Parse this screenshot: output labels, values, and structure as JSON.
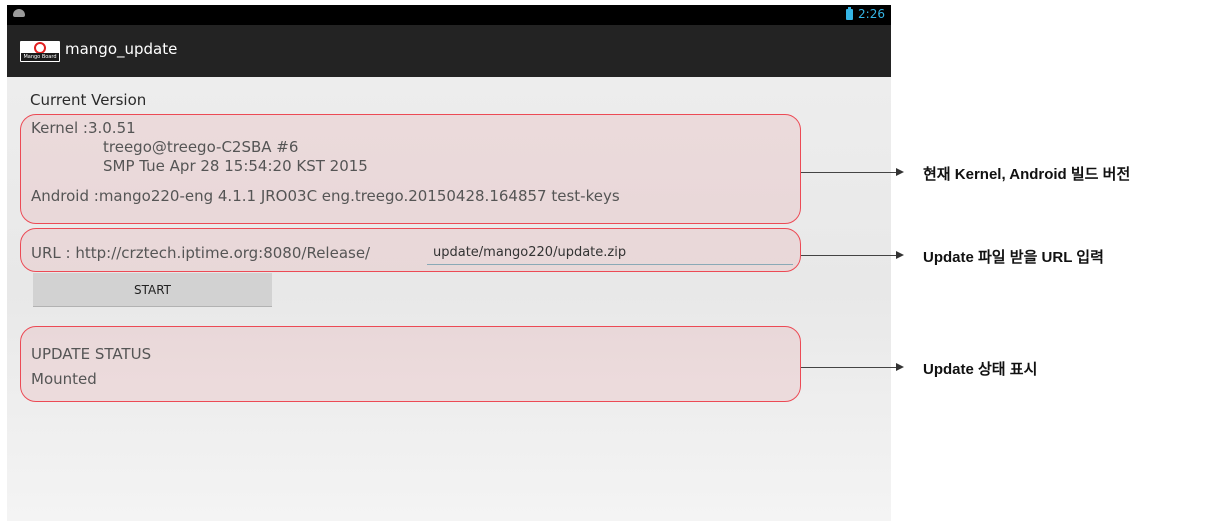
{
  "statusbar": {
    "time": "2:26",
    "notification_icon": "android-icon",
    "battery_icon": "battery-icon",
    "accent_color": "#35b5e5"
  },
  "actionbar": {
    "logo_text": "Mango Board",
    "title": "mango_update"
  },
  "current_version": {
    "heading": "Current Version",
    "kernel_line": "Kernel :3.0.51",
    "kernel_user": "treego@treego-C2SBA #6",
    "kernel_build": "SMP Tue Apr 28 15:54:20 KST 2015",
    "android_line": "Android :mango220-eng 4.1.1 JRO03C eng.treego.20150428.164857 test-keys"
  },
  "url": {
    "label": "URL : http://crztech.iptime.org:8080/Release/",
    "value": "update/mango220/update.zip"
  },
  "start_button": {
    "label": "START"
  },
  "update_status": {
    "heading": "UPDATE STATUS",
    "value": "Mounted"
  },
  "annotations": {
    "version": "현재 Kernel, Android 빌드 버전",
    "url": "Update 파일 받을 URL 입력",
    "status": "Update 상태 표시"
  },
  "colors": {
    "highlight_border": "#ec4a55",
    "actionbar": "#232323"
  }
}
